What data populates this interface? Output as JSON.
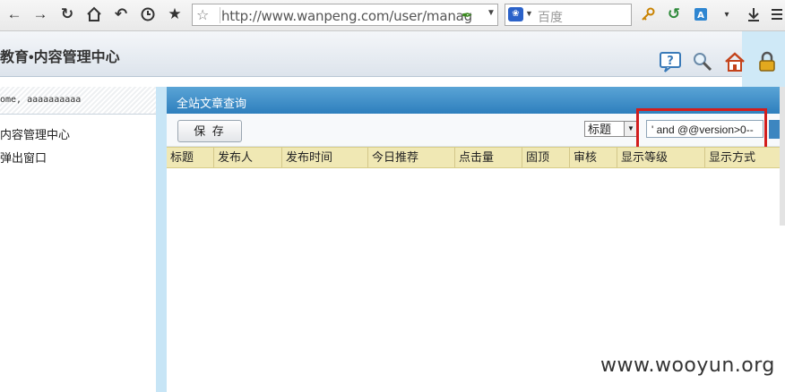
{
  "browser": {
    "url": "http://www.wanpeng.com/user/manage",
    "search_placeholder": "百度",
    "search_engine_icon": "paw-icon"
  },
  "header": {
    "title": "教育•内容管理中心",
    "icons": [
      "help-icon",
      "search-icon",
      "home-icon",
      "lock-icon"
    ]
  },
  "sidebar": {
    "welcome": "ome, aaaaaaaaaa",
    "items": [
      {
        "label": "内容管理中心"
      },
      {
        "label": "弹出窗口"
      }
    ]
  },
  "main": {
    "title": "全站文章查询",
    "save_label": "保 存",
    "field_select_value": "标题",
    "search_value": "' and @@version>0--",
    "columns": [
      "标题",
      "发布人",
      "发布时间",
      "今日推荐",
      "点击量",
      "固顶",
      "审核",
      "显示等级",
      "显示方式"
    ]
  },
  "watermark": "www.wooyun.org",
  "colors": {
    "title_bar": "#2e7fbd",
    "table_header": "#f0e8b4",
    "highlight": "#d21d1d"
  }
}
